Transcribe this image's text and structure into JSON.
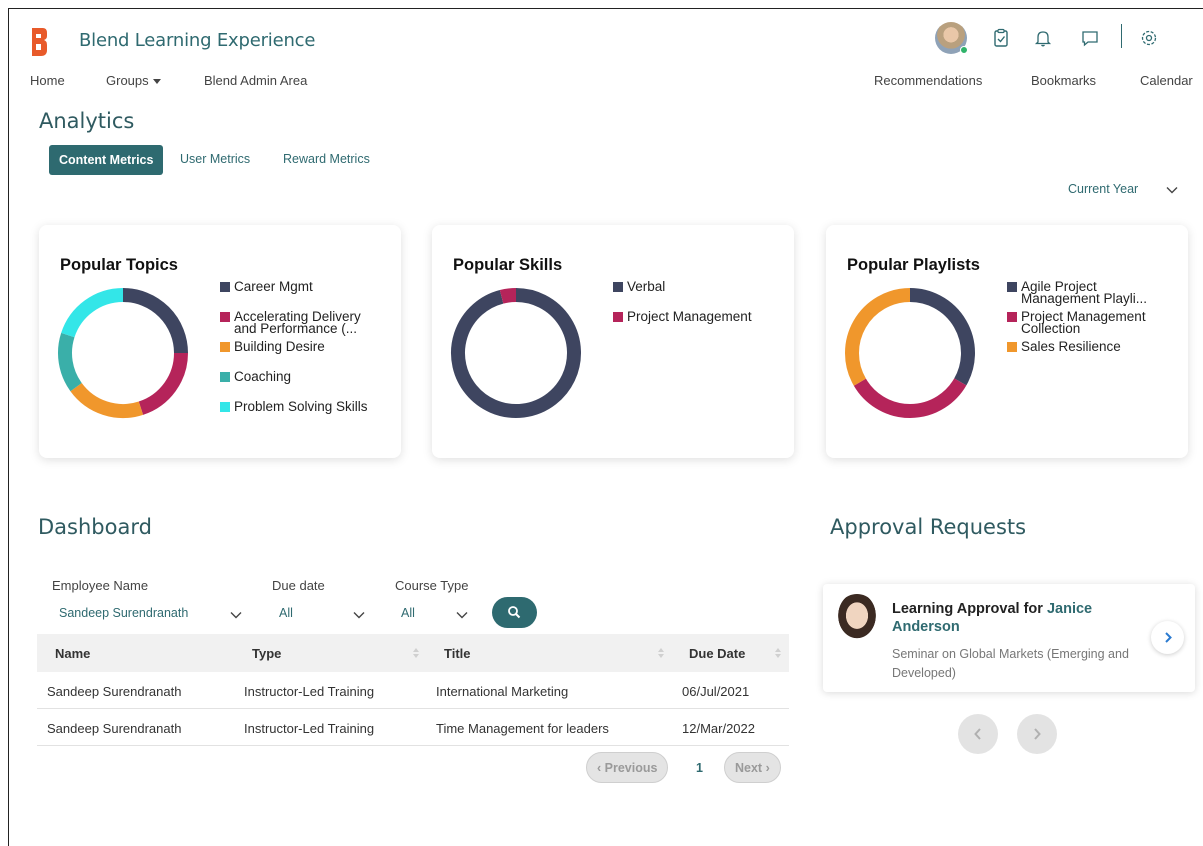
{
  "app": {
    "title": "Blend Learning Experience",
    "brand_color": "#e85a2a",
    "accent_color": "#2e6a70"
  },
  "nav": {
    "home": "Home",
    "groups": "Groups",
    "admin": "Blend Admin Area",
    "recommendations": "Recommendations",
    "bookmarks": "Bookmarks",
    "calendar": "Calendar"
  },
  "top_icons": [
    "avatar",
    "clipboard-icon",
    "bell-icon",
    "chat-icon",
    "gear-icon"
  ],
  "analytics": {
    "heading": "Analytics",
    "tabs": [
      "Content Metrics",
      "User Metrics",
      "Reward Metrics"
    ],
    "active_tab": "Content Metrics",
    "period": "Current Year"
  },
  "cards": [
    {
      "title": "Popular Topics",
      "legend": [
        {
          "line1": "Career Mgmt",
          "line2": "",
          "color": "#3e4560"
        },
        {
          "line1": "Accelerating Delivery",
          "line2": "and Performance (...",
          "color": "#b5245a"
        },
        {
          "line1": "Building Desire",
          "line2": "",
          "color": "#f0972c"
        },
        {
          "line1": "Coaching",
          "line2": "",
          "color": "#3aafa9"
        },
        {
          "line1": "Problem Solving Skills",
          "line2": "",
          "color": "#33e6e8"
        }
      ]
    },
    {
      "title": "Popular Skills",
      "legend": [
        {
          "line1": "Verbal",
          "line2": "",
          "color": "#3e4560"
        },
        {
          "line1": "Project Management",
          "line2": "",
          "color": "#b5245a"
        }
      ]
    },
    {
      "title": "Popular Playlists",
      "legend": [
        {
          "line1": "Agile Project",
          "line2": "Management Playli...",
          "color": "#3e4560"
        },
        {
          "line1": "Project Management",
          "line2": "Collection",
          "color": "#b5245a"
        },
        {
          "line1": "Sales Resilience",
          "line2": "",
          "color": "#f0972c"
        }
      ]
    }
  ],
  "chart_data": [
    {
      "type": "pie",
      "title": "Popular Topics",
      "categories": [
        "Career Mgmt",
        "Accelerating Delivery and Performance (...",
        "Building Desire",
        "Coaching",
        "Problem Solving Skills"
      ],
      "values": [
        25,
        20,
        20,
        15,
        20
      ],
      "colors": [
        "#3e4560",
        "#b5245a",
        "#f0972c",
        "#3aafa9",
        "#33e6e8"
      ]
    },
    {
      "type": "pie",
      "title": "Popular Skills",
      "categories": [
        "Verbal",
        "Project Management"
      ],
      "values": [
        96,
        4
      ],
      "colors": [
        "#3e4560",
        "#b5245a"
      ]
    },
    {
      "type": "pie",
      "title": "Popular Playlists",
      "categories": [
        "Agile Project Management Playli...",
        "Project Management Collection",
        "Sales Resilience"
      ],
      "values": [
        33.3,
        33.3,
        33.4
      ],
      "colors": [
        "#3e4560",
        "#b5245a",
        "#f0972c"
      ]
    }
  ],
  "dashboard": {
    "heading": "Dashboard",
    "filters": {
      "employee_label": "Employee Name",
      "employee_value": "Sandeep Surendranath",
      "due_label": "Due date",
      "due_value": "All",
      "course_label": "Course Type",
      "course_value": "All"
    },
    "columns": [
      "Name",
      "Type",
      "Title",
      "Due Date"
    ],
    "rows": [
      [
        "Sandeep Surendranath",
        "Instructor-Led Training",
        "International Marketing",
        "06/Jul/2021"
      ],
      [
        "Sandeep Surendranath",
        "Instructor-Led Training",
        "Time Management for leaders",
        "12/Mar/2022"
      ]
    ],
    "pager": {
      "previous": "Previous",
      "page": "1",
      "next": "Next"
    }
  },
  "approvals": {
    "heading": "Approval Requests",
    "title_prefix": "Learning Approval for",
    "person": "Janice Anderson",
    "description": "Seminar on Global Markets (Emerging and Developed)"
  }
}
